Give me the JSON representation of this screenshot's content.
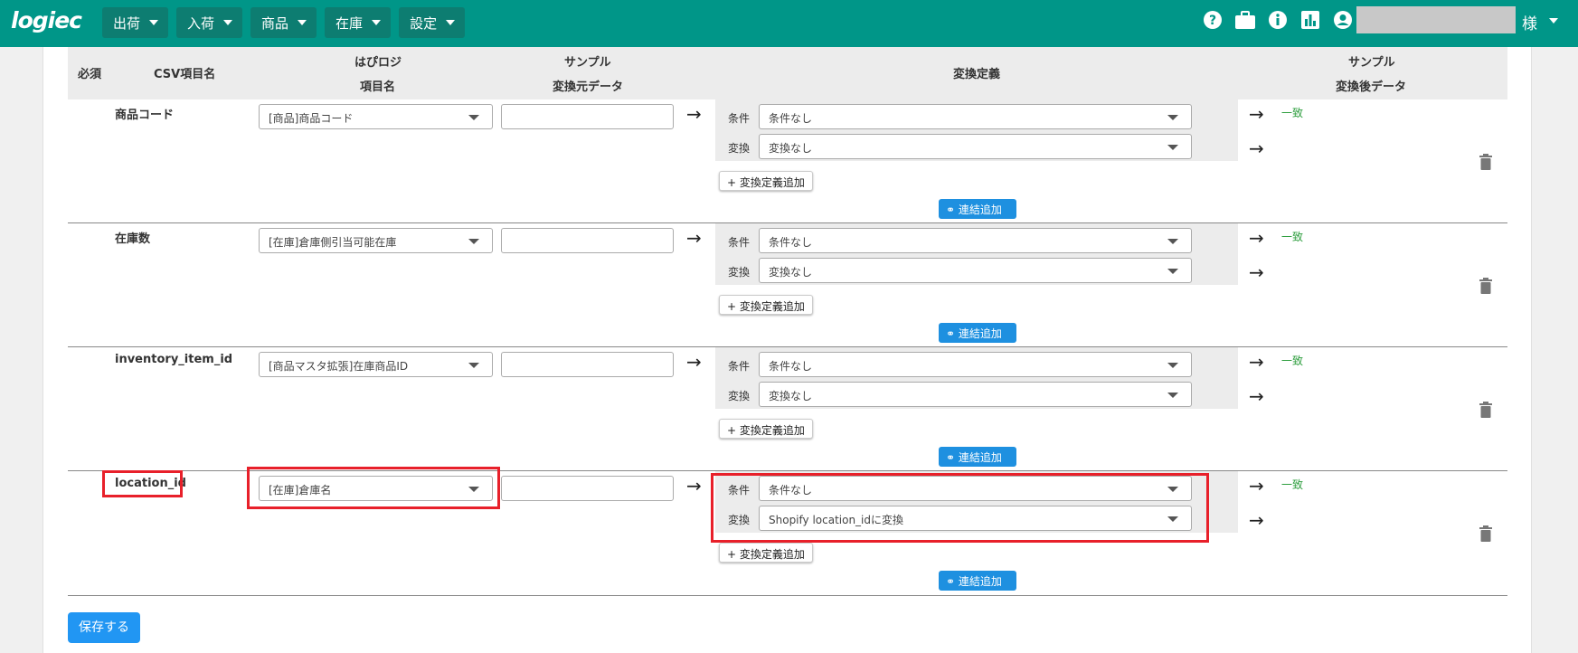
{
  "app": {
    "logo": "logiec"
  },
  "nav": {
    "menu": [
      "出荷",
      "入荷",
      "商品",
      "在庫",
      "設定"
    ],
    "user_suffix": "様"
  },
  "table": {
    "headers": {
      "required": "必須",
      "csv_item": "CSV項目名",
      "hab_line1": "はぴロジ",
      "hab_line2": "項目名",
      "sample_src_line1": "サンプル",
      "sample_src_line2": "変換元データ",
      "conversion": "変換定義",
      "sample_out_line1": "サンプル",
      "sample_out_line2": "変換後データ"
    },
    "row_labels": {
      "condition": "条件",
      "transform": "変換",
      "add_definition": "+ 変換定義追加",
      "add_link": "連結追加",
      "match": "一致"
    },
    "rows": [
      {
        "csv_item": "商品コード",
        "mapping": "[商品]商品コード",
        "condition": "条件なし",
        "transform": "変換なし"
      },
      {
        "csv_item": "在庫数",
        "mapping": "[在庫]倉庫側引当可能在庫",
        "condition": "条件なし",
        "transform": "変換なし"
      },
      {
        "csv_item": "inventory_item_id",
        "mapping": "[商品マスタ拡張]在庫商品ID",
        "condition": "条件なし",
        "transform": "変換なし"
      },
      {
        "csv_item": "location_id",
        "mapping": "[在庫]倉庫名",
        "condition": "条件なし",
        "transform": "Shopify location_idに変換"
      }
    ]
  },
  "save_label": "保存する",
  "colors": {
    "navbar": "#009688",
    "primary": "#2196f3",
    "highlight": "#e8202a",
    "match": "#2e9e3e"
  }
}
